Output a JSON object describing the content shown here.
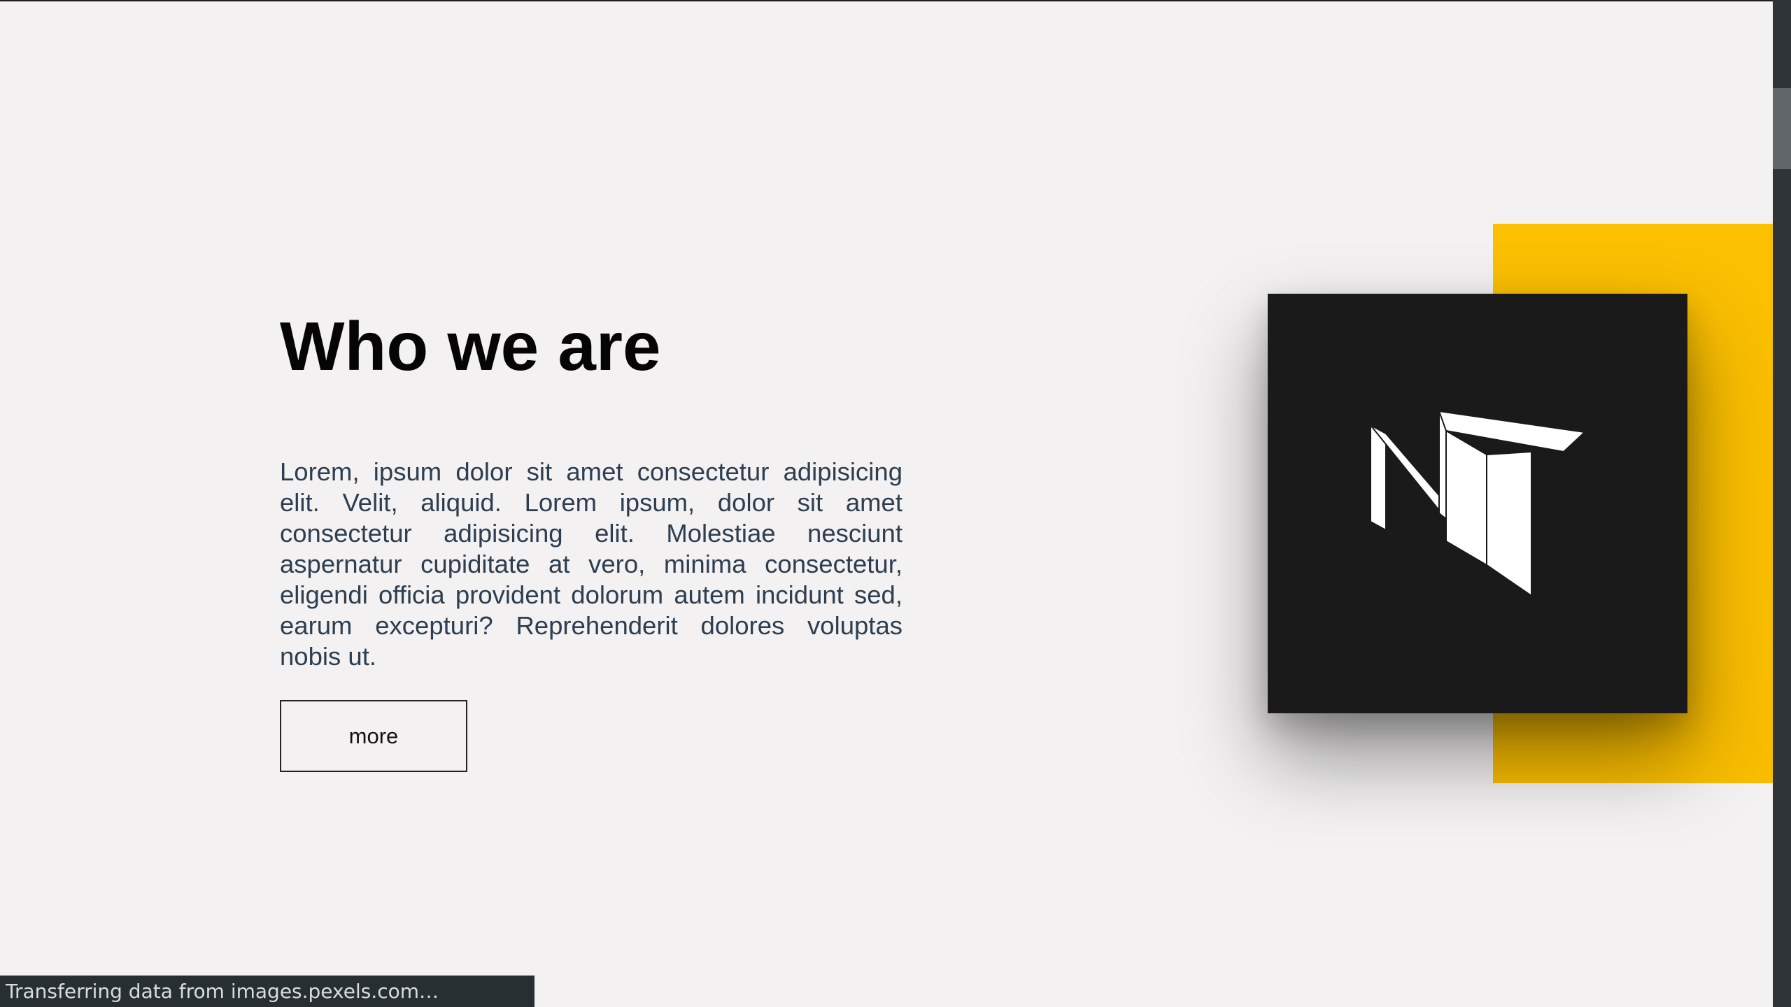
{
  "about": {
    "title": "Who we are",
    "body": "Lorem, ipsum dolor sit amet consectetur adipisicing elit. Velit, aliquid. Lorem ipsum, dolor sit amet consectetur adipisicing elit. Molestiae nesciunt aspernatur cupiditate at vero, minima consectetur, eligendi officia provident dolorum autem incidunt sed, earum excepturi? Reprehenderit dolores voluptas nobis ut.",
    "more_label": "more"
  },
  "logo": {
    "icon": "nt-logo-icon"
  },
  "browser": {
    "status_text": "Transferring data from images.pexels.com…"
  },
  "colors": {
    "accent": "#fbc002",
    "card": "#1a1a1a",
    "background": "#f3f1f1",
    "body_text": "#2c3e50"
  }
}
